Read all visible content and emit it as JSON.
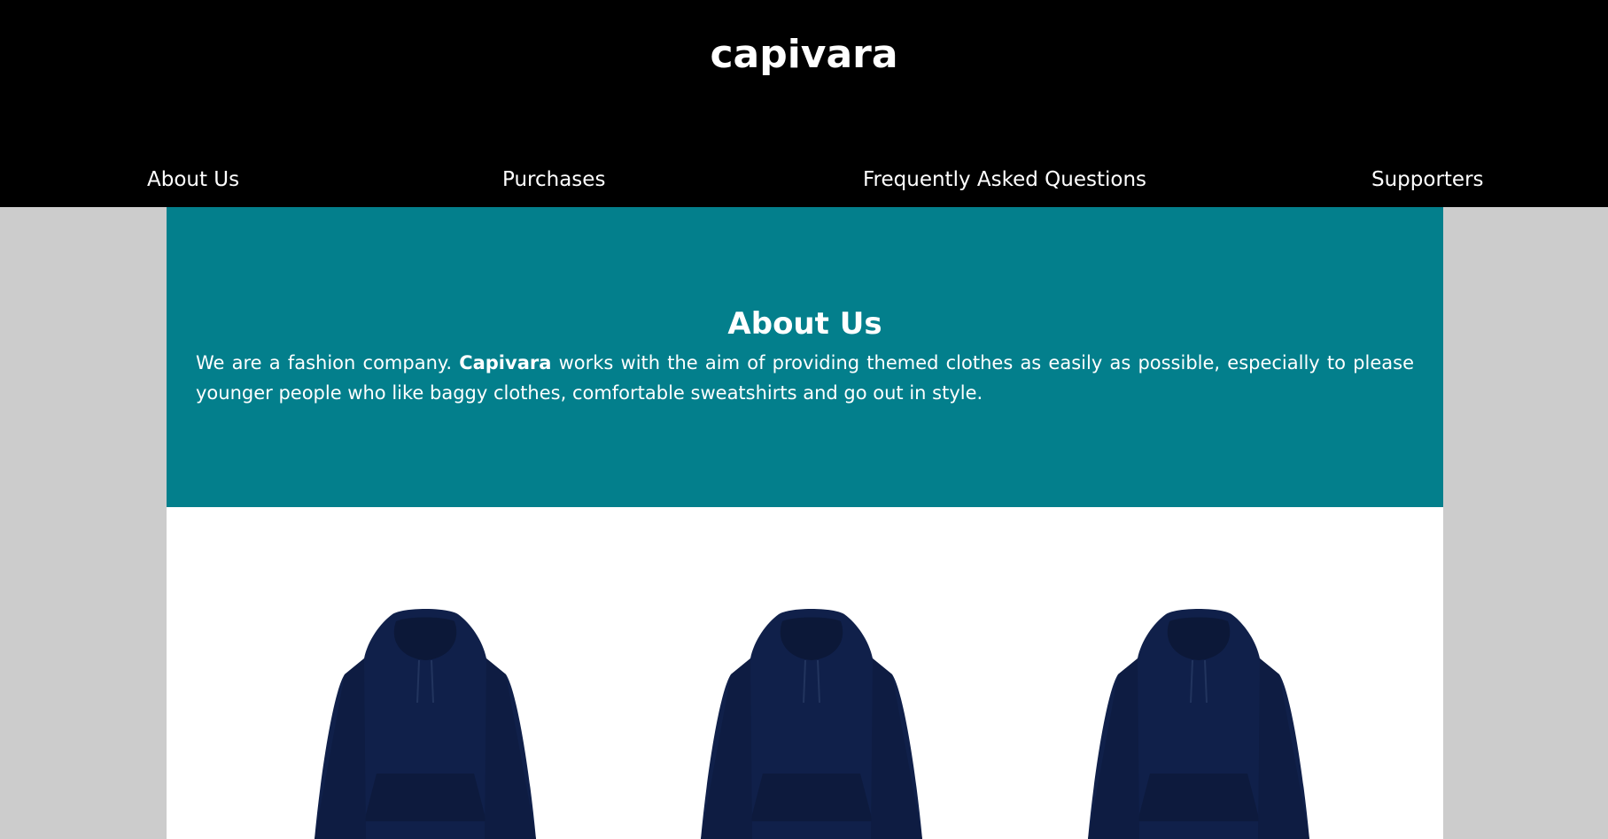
{
  "header": {
    "logo": "capivara"
  },
  "nav": {
    "items": [
      {
        "label": "About Us"
      },
      {
        "label": "Purchases"
      },
      {
        "label": "Frequently Asked Questions"
      },
      {
        "label": "Supporters"
      }
    ]
  },
  "about": {
    "title": "About Us",
    "text_before": "We are a fashion company. ",
    "brand": "Capivara",
    "text_after": " works with the aim of providing themed clothes as easily as possible, especially to please younger people who like baggy clothes, comfortable sweatshirts and go out in style."
  },
  "products": [
    {
      "icon": "hoodie-icon",
      "color": "#10204a"
    },
    {
      "icon": "hoodie-icon",
      "color": "#10204a"
    },
    {
      "icon": "hoodie-icon",
      "color": "#10204a"
    }
  ],
  "colors": {
    "header_bg": "#000000",
    "about_bg": "#037f8c",
    "page_bg": "#cccccc",
    "content_bg": "#ffffff",
    "hoodie": "#10204a"
  }
}
